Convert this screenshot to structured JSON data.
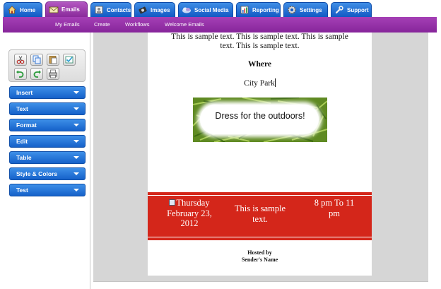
{
  "tabs": [
    {
      "label": "Home",
      "icon": "house-icon",
      "active": false
    },
    {
      "label": "Emails",
      "icon": "envelope-icon",
      "active": true
    },
    {
      "label": "Contacts",
      "icon": "contacts-icon",
      "active": false
    },
    {
      "label": "Images",
      "icon": "camera-icon",
      "active": false
    },
    {
      "label": "Social Media",
      "icon": "cloud-icon",
      "active": false
    },
    {
      "label": "Reporting",
      "icon": "chart-icon",
      "active": false
    },
    {
      "label": "Settings",
      "icon": "gear-icon",
      "active": false
    },
    {
      "label": "Support",
      "icon": "wrench-icon",
      "active": false
    }
  ],
  "subnav": [
    "My Emails",
    "Create",
    "Workflows",
    "Welcome Emails"
  ],
  "toolbox": {
    "buttons": [
      "cut-icon",
      "copy-icon",
      "paste-icon",
      "paste-special-icon",
      "undo-icon",
      "redo-icon",
      "print-icon"
    ]
  },
  "menu": [
    "Insert",
    "Text",
    "Format",
    "Edit",
    "Table",
    "Style & Colors",
    "Test"
  ],
  "document": {
    "sample_text": "This is sample text. This is sample text. This is sample text. This is sample text.",
    "where_heading": "Where",
    "where_value": "City Park",
    "banner_text": "Dress for the outdoors!",
    "event": {
      "date": "Thursday February 23, 2012",
      "middle": "This is sample text.",
      "time": "8 pm To 11 pm"
    },
    "hosted_by": "Hosted by",
    "sender": "Sender's Name"
  },
  "colors": {
    "tab_blue": "#1a66cc",
    "tab_active_purple": "#9a35ad",
    "event_band_red": "#d4261a",
    "canvas_gray": "#d6d6d6"
  }
}
